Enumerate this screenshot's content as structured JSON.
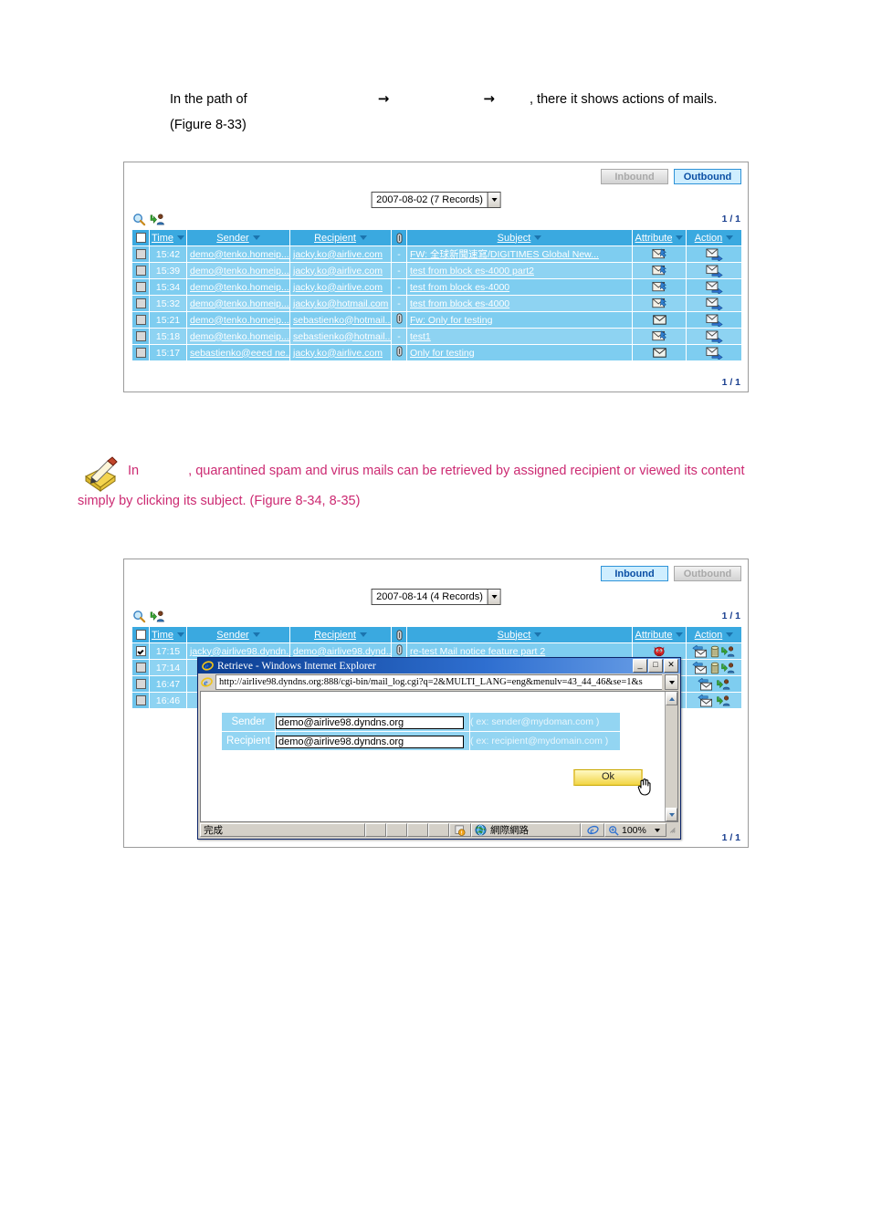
{
  "intro": {
    "line1_a": "In the path of",
    "line1_arrow1": "→",
    "line1_arrow2": "→",
    "line1_b": ", there it shows actions of mails.",
    "line2": "(Figure 8-33)"
  },
  "note": {
    "icon": "note-pencil-icon",
    "part1": "In",
    "part2": ", quarantined spam and virus mails can be retrieved by assigned recipient or viewed its content",
    "part3": "simply by clicking its subject. (Figure 8-34, 8-35)",
    "color": "#cc2a72"
  },
  "figure1": {
    "tabs": {
      "inbound": "Inbound",
      "outbound": "Outbound",
      "active": "Outbound"
    },
    "date_select": {
      "value": "2007-08-02 (7 Records)"
    },
    "toolbar_icons": [
      "search-icon",
      "export-user-icon"
    ],
    "pager_top": "1 / 1",
    "pager_bottom": "1 / 1",
    "columns": [
      "",
      "Time",
      "Sender",
      "Recipient",
      "",
      "Subject",
      "Attribute",
      "Action"
    ],
    "clip_header_icon": "paperclip-icon",
    "rows": [
      {
        "checked": false,
        "time": "15:42",
        "sender": "demo@tenko.homeip....",
        "recipient": "jacky.ko@airlive.com",
        "clip": "-",
        "subject": "FW: 全球新聞速寫/DIGITIMES Global New...",
        "attribute": "mail-notice-icon",
        "action": [
          "forward-mail-icon"
        ]
      },
      {
        "checked": false,
        "time": "15:39",
        "sender": "demo@tenko.homeip....",
        "recipient": "jacky.ko@airlive.com",
        "clip": "-",
        "subject": "test from block es-4000 part2",
        "attribute": "mail-notice-icon",
        "action": [
          "forward-mail-icon"
        ]
      },
      {
        "checked": false,
        "time": "15:34",
        "sender": "demo@tenko.homeip....",
        "recipient": "jacky.ko@airlive.com",
        "clip": "-",
        "subject": "test from block es-4000",
        "attribute": "mail-notice-icon",
        "action": [
          "forward-mail-icon"
        ]
      },
      {
        "checked": false,
        "time": "15:32",
        "sender": "demo@tenko.homeip....",
        "recipient": "jacky.ko@hotmail.com",
        "clip": "-",
        "subject": "test from block es-4000",
        "attribute": "mail-notice-icon",
        "action": [
          "forward-mail-icon"
        ]
      },
      {
        "checked": false,
        "time": "15:21",
        "sender": "demo@tenko.homeip....",
        "recipient": "sebastienko@hotmail...",
        "clip": "paperclip-icon",
        "subject": "Fw: Only for testing",
        "attribute": "mail-plain-icon",
        "action": [
          "forward-mail-icon"
        ]
      },
      {
        "checked": false,
        "time": "15:18",
        "sender": "demo@tenko.homeip....",
        "recipient": "sebastienko@hotmail...",
        "clip": "-",
        "subject": "test1",
        "attribute": "mail-notice-icon",
        "action": [
          "forward-mail-icon"
        ]
      },
      {
        "checked": false,
        "time": "15:17",
        "sender": "sebastienko@eeed ne...",
        "recipient": "jacky.ko@airlive.com",
        "clip": "paperclip-icon",
        "subject": "Only for testing",
        "attribute": "mail-plain-icon",
        "action": [
          "forward-mail-icon"
        ]
      }
    ]
  },
  "figure2": {
    "tabs": {
      "inbound": "Inbound",
      "outbound": "Outbound",
      "active": "Inbound"
    },
    "date_select": {
      "value": "2007-08-14 (4 Records)"
    },
    "toolbar_icons": [
      "search-icon",
      "export-user-icon"
    ],
    "pager_top": "1 / 1",
    "pager_bottom": "1 / 1",
    "columns": [
      "",
      "Time",
      "Sender",
      "Recipient",
      "",
      "Subject",
      "Attribute",
      "Action"
    ],
    "clip_header_icon": "paperclip-icon",
    "rows": [
      {
        "checked": true,
        "time": "17:15",
        "sender": "jacky@airlive98.dyndn...",
        "recipient": "demo@airlive98.dynd...",
        "clip": "paperclip-icon",
        "subject": "re-test Mail notice feature part 2",
        "attribute": "virus-devil-icon",
        "action": [
          "retrieve-mail-icon",
          "delete-icon",
          "assign-user-icon"
        ]
      },
      {
        "checked": false,
        "time": "17:14",
        "sender": "",
        "recipient": "",
        "clip": "",
        "subject": "",
        "attribute": "",
        "action": [
          "retrieve-mail-icon",
          "delete-icon",
          "assign-user-icon"
        ]
      },
      {
        "checked": false,
        "time": "16:47",
        "sender": "",
        "recipient": "",
        "clip": "",
        "subject": "",
        "attribute": "",
        "action": [
          "retrieve-mail-icon",
          "assign-user-icon"
        ]
      },
      {
        "checked": false,
        "time": "16:46",
        "sender": "",
        "recipient": "",
        "clip": "",
        "subject": "",
        "attribute": "",
        "action": [
          "retrieve-mail-icon",
          "assign-user-icon"
        ]
      }
    ],
    "dialog": {
      "title": "Retrieve - Windows Internet Explorer",
      "title_icon": "internet-explorer-icon",
      "window_buttons": {
        "minimize": "_",
        "maximize": "□",
        "close": "✕"
      },
      "address": "http://airlive98.dyndns.org:888/cgi-bin/mail_log.cgi?q=2&MULTI_LANG=eng&menulv=43_44_46&se=1&s",
      "address_icon": "internet-explorer-icon",
      "form": {
        "sender_label": "Sender",
        "sender_value": "demo@airlive98.dyndns.org",
        "sender_hint": "( ex: sender@mydoman.com )",
        "recipient_label": "Recipient",
        "recipient_value": "demo@airlive98.dyndns.org",
        "recipient_hint": "( ex: recipient@mydomain.com )"
      },
      "ok_label": "Ok",
      "cursor": "hand-pointer-cursor",
      "status": {
        "text": "完成",
        "zone_icon": "globe-icon",
        "zone": "網際網路",
        "warn_icon": "warning-icon",
        "browser_icon": "internet-explorer-icon",
        "zoom_icon": "zoom-icon",
        "zoom": "100%"
      }
    }
  }
}
